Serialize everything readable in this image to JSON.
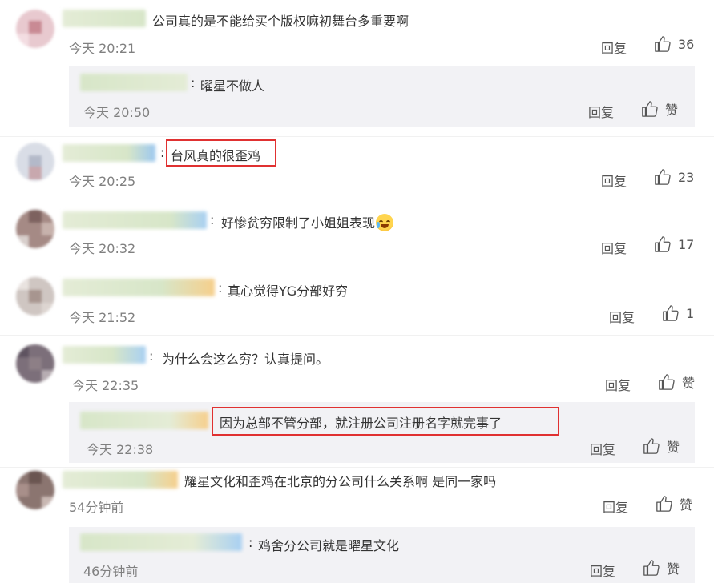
{
  "labels": {
    "reply": "回复",
    "colon": ":",
    "like_word": "赞"
  },
  "colors": {
    "text": "#333333",
    "meta": "#808080",
    "highlight": "#e03131",
    "reply_bg": "#f2f2f5"
  },
  "comments": [
    {
      "text": "公司真的是不能给买个版权嘛初舞台多重要啊",
      "time": "今天 20:21",
      "likes": "36"
    },
    {
      "text": "曜星不做人",
      "time": "今天 20:50",
      "likes": "赞"
    },
    {
      "text": "台风真的很歪鸡",
      "time": "今天 20:25",
      "likes": "23"
    },
    {
      "text": "好惨贫穷限制了小姐姐表现",
      "time": "今天 20:32",
      "likes": "17",
      "emoji": "crying-laughing-emoji"
    },
    {
      "text": "真心觉得YG分部好穷",
      "time": "今天 21:52",
      "likes": "1"
    },
    {
      "text": "为什么会这么穷？认真提问。",
      "time": "今天 22:35",
      "likes": "赞"
    },
    {
      "text": "因为总部不管分部，就注册公司注册名字就完事了",
      "time": "今天 22:38",
      "likes": "赞"
    },
    {
      "text": "耀星文化和歪鸡在北京的分公司什么关系啊 是同一家吗",
      "time": "54分钟前",
      "likes": "赞"
    },
    {
      "text": "鸡舍分公司就是曜星文化",
      "time": "46分钟前",
      "likes": "赞"
    }
  ]
}
